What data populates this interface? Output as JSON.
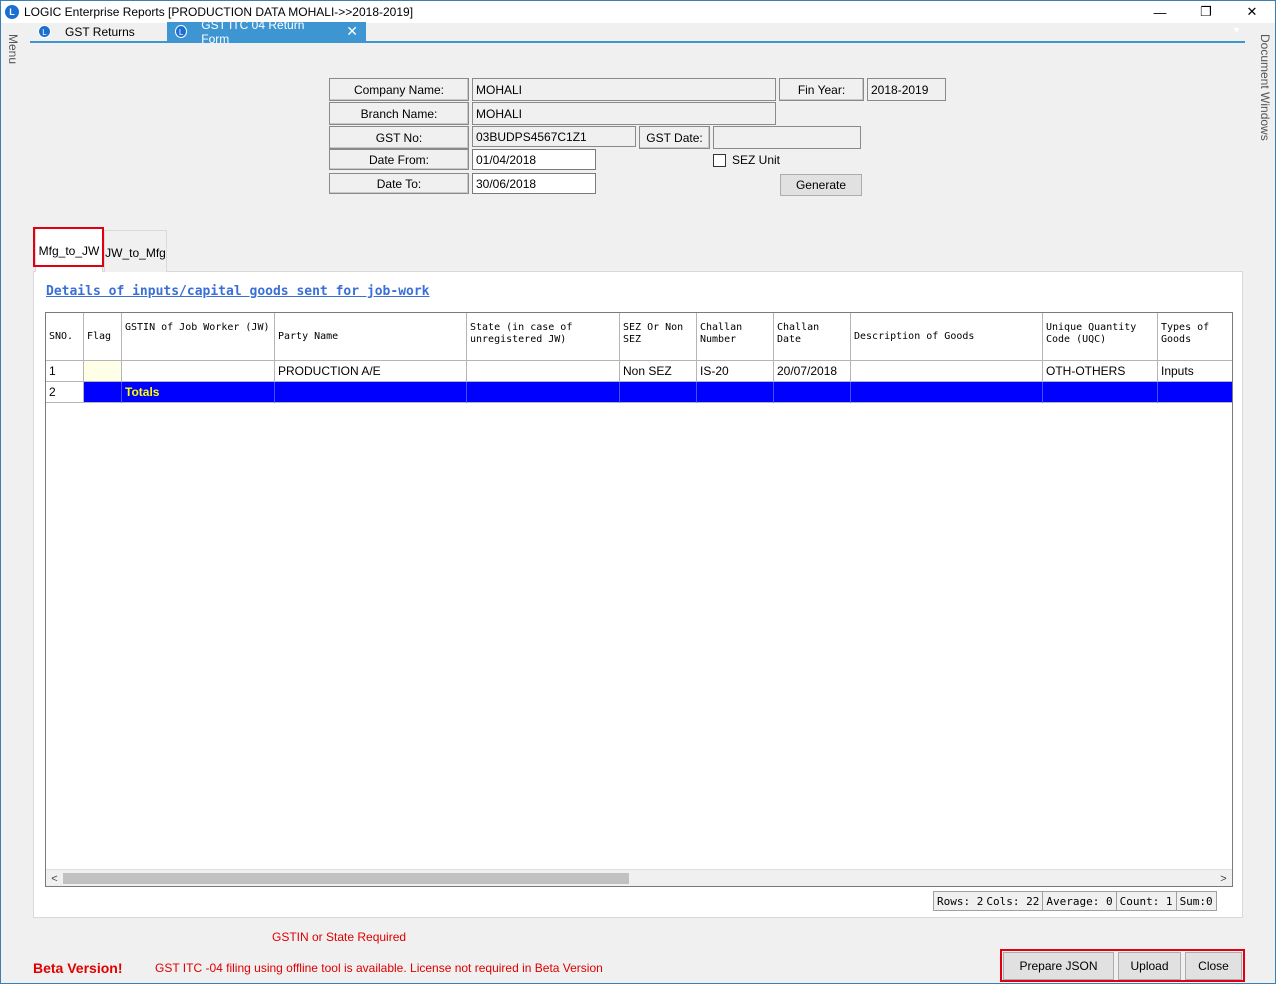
{
  "window": {
    "title": "LOGIC Enterprise Reports  [PRODUCTION DATA MOHALI->>2018-2019]",
    "minimize": "—",
    "restore": "❐",
    "close": "✕"
  },
  "doc_tabs": [
    {
      "label": "GST Returns",
      "active": false
    },
    {
      "label": "GST ITC 04 Return Form",
      "active": true
    }
  ],
  "side": {
    "menu": "Menu",
    "document_windows": "Document Windows"
  },
  "form": {
    "company_name_label": "Company Name:",
    "company_name": "MOHALI",
    "fin_year_label": "Fin Year:",
    "fin_year": "2018-2019",
    "branch_name_label": "Branch Name:",
    "branch_name": "MOHALI",
    "gst_no_label": "GST No:",
    "gst_no": "03BUDPS4567C1Z1",
    "gst_date_label": "GST Date:",
    "gst_date": "",
    "date_from_label": "Date From:",
    "date_from": "01/04/2018",
    "date_to_label": "Date To:",
    "date_to": "30/06/2018",
    "sez_unit_label": "SEZ Unit",
    "generate_label": "Generate"
  },
  "inner_tabs": [
    {
      "label": "Mfg_to_JW",
      "active": true
    },
    {
      "label": "JW_to_Mfg",
      "active": false
    }
  ],
  "details_title": "Details of inputs/capital goods sent for job-work",
  "grid": {
    "columns": [
      "SNO.",
      "Flag",
      "GSTIN of Job Worker (JW)",
      "Party Name",
      "State (in case of unregistered JW)",
      "SEZ Or Non SEZ",
      "Challan Number",
      "Challan Date",
      "Description of Goods",
      "Unique Quantity Code (UQC)",
      "Types of Goods"
    ],
    "rows": [
      [
        "1",
        "",
        "",
        "PRODUCTION A/E",
        "",
        "Non SEZ",
        "IS-20",
        "20/07/2018",
        "",
        "OTH-OTHERS",
        "Inputs"
      ]
    ],
    "totals_row": {
      "sno": "2",
      "label": "Totals"
    },
    "scroll_left": "<",
    "scroll_right": ">"
  },
  "status": {
    "rows": "Rows: 2",
    "cols": "Cols: 22",
    "average": "Average: 0",
    "count": "Count: 1",
    "sum": "Sum:0"
  },
  "error_message": "GSTIN or State Required",
  "beta_label": "Beta Version!",
  "beta_info": "GST ITC -04 filing using offline tool is available. License not required in Beta Version",
  "buttons": {
    "prepare_json": "Prepare JSON",
    "upload": "Upload",
    "close": "Close"
  },
  "colors": {
    "accent": "#3d95d1",
    "totals_bg": "#0000ff",
    "totals_text": "#ffff00",
    "alert_red": "#e00000"
  }
}
